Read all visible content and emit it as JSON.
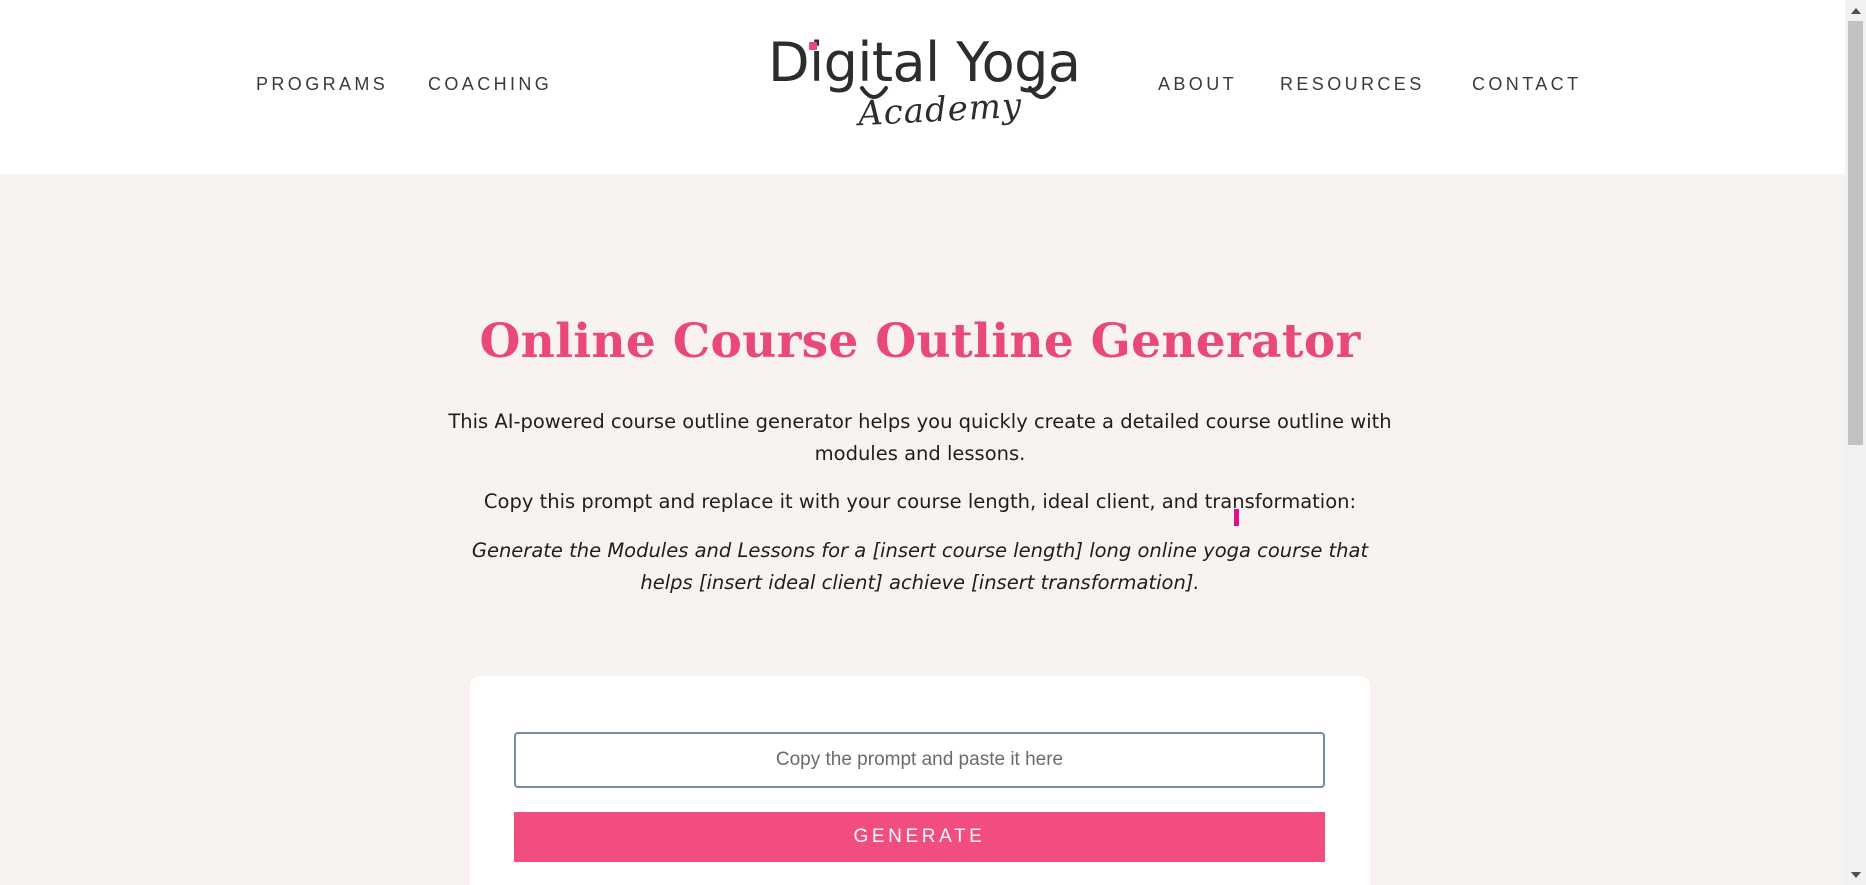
{
  "nav": {
    "programs": "PROGRAMS",
    "coaching": "COACHING",
    "about": "ABOUT",
    "resources": "RESOURCES",
    "contact": "CONTACT"
  },
  "logo": {
    "main_text": "Digital Yoga",
    "script_text": "Academy",
    "accent_color": "#e8487b"
  },
  "hero": {
    "title": "Online Course Outline Generator",
    "description": "This AI-powered course outline generator helps you quickly create a detailed course outline with modules and lessons.",
    "instruction": "Copy this prompt and replace it with your course length, ideal client, and transformation:",
    "prompt_template": "Generate the Modules and Lessons for a [insert course length] long online yoga course that helps [insert ideal client] achieve [insert transformation]."
  },
  "form": {
    "input_placeholder": "Copy the prompt and paste it here",
    "input_value": "",
    "generate_label": "GENERATE"
  },
  "colors": {
    "brand_pink": "#e8487b",
    "button_pink": "#f24d80",
    "page_background": "#f8f3f1"
  },
  "icons": {
    "scroll_up": "scroll-up-arrow-icon",
    "scroll_down": "scroll-down-arrow-icon"
  }
}
